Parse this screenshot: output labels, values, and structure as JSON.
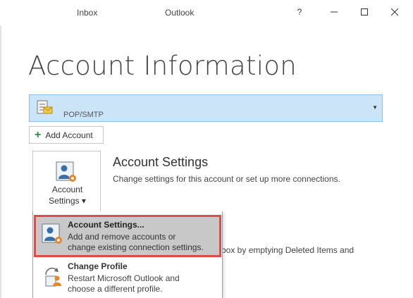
{
  "titlebar": {
    "folder": "Inbox",
    "app": "Outlook",
    "help_glyph": "?",
    "minimize_glyph": "—",
    "maximize_glyph": "☐",
    "close_glyph": "✕"
  },
  "page_title": "Account Information",
  "account": {
    "type": "POP/SMTP",
    "icon": "mail-server-icon",
    "dropdown_glyph": "▼"
  },
  "add_account": {
    "plus_glyph": "+",
    "label": "Add Account"
  },
  "account_settings_tile": {
    "icon": "user-gear-icon",
    "label_line1": "Account",
    "label_line2": "Settings ▾"
  },
  "section": {
    "title": "Account Settings",
    "description": "Change settings for this account or set up more connections."
  },
  "background_text": "box by emptying Deleted Items and",
  "menu": {
    "items": [
      {
        "title": "Account Settings...",
        "description_line1": "Add and remove accounts or",
        "description_line2": "change existing connection settings.",
        "icon": "user-gear-icon"
      },
      {
        "title": "Change Profile",
        "description_line1": "Restart Microsoft Outlook and",
        "description_line2": "choose a different profile.",
        "icon": "change-profile-icon"
      }
    ]
  },
  "colors": {
    "account_bar": "#cce4f7",
    "highlight": "#c8c8c8",
    "highlight_border": "#e04a4a",
    "accent": "#2e8b47"
  }
}
